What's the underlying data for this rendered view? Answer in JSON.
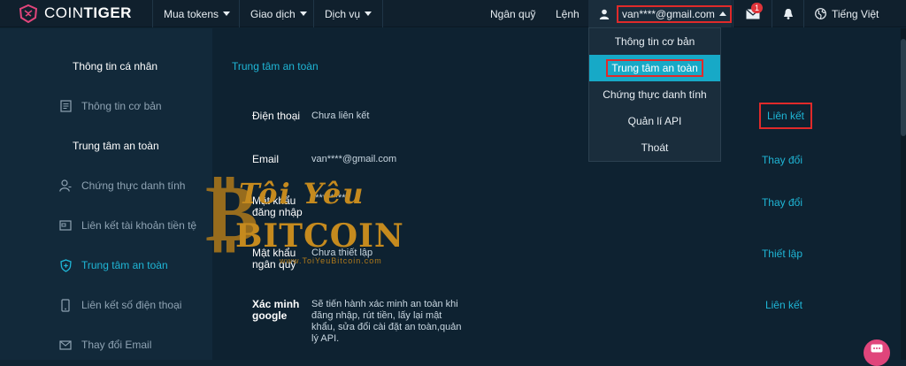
{
  "header": {
    "logo_text_light": "COIN",
    "logo_text_bold": "TIGER",
    "nav": [
      {
        "label": "Mua tokens"
      },
      {
        "label": "Giao dịch"
      },
      {
        "label": "Dịch vụ"
      }
    ],
    "wallet_label": "Ngân quỹ",
    "orders_label": "Lệnh",
    "user_email": "van****@gmail.com",
    "message_badge": "1",
    "language_label": "Tiếng Việt"
  },
  "dropdown": {
    "items": [
      {
        "label": "Thông tin cơ bản"
      },
      {
        "label": "Trung tâm an toàn"
      },
      {
        "label": "Chứng thực danh tính"
      },
      {
        "label": "Quản lí API"
      },
      {
        "label": "Thoát"
      }
    ]
  },
  "sidebar": {
    "section_personal": "Thông tin cá nhân",
    "item_basic_info": "Thông tin cơ bản",
    "section_security": "Trung tâm an toàn",
    "items": [
      {
        "label": "Chứng thực danh tính"
      },
      {
        "label": "Liên kết tài khoản tiền tệ"
      },
      {
        "label": "Trung tâm an toàn"
      },
      {
        "label": "Liên kết số điện thoại"
      },
      {
        "label": "Thay đổi Email"
      }
    ]
  },
  "main": {
    "breadcrumb": "Trung tâm an toàn",
    "rows": [
      {
        "label": "Điện thoại",
        "value": "Chưa liên kết",
        "action": "Liên kết"
      },
      {
        "label": "Email",
        "value": "van****@gmail.com",
        "action": "Thay đổi"
      },
      {
        "label_line1": "Mật khẩu",
        "label_line2": "đăng nhập",
        "value": "**********",
        "action": "Thay đổi"
      },
      {
        "label_line1": "Mật khẩu",
        "label_line2": "ngân quỹ",
        "value": "Chưa thiết lập",
        "action": "Thiết lập"
      },
      {
        "label_line1": "Xác minh",
        "label_line2": "google",
        "value_lines": [
          "Sẽ tiến hành xác minh an toàn khi",
          "đăng nhập, rút tiền, lấy lại mật",
          "khẩu, sửa đổi cài đặt an toàn,quản",
          "lý API."
        ],
        "action": "Liên kết"
      }
    ]
  },
  "watermark": {
    "title": "Tôi Yêu",
    "brand": "BITCOIN",
    "symbol": "₿",
    "url": "www.ToiYeuBitcoin.com"
  },
  "colors": {
    "accent": "#1fb6d6",
    "highlight": "#e02a2a",
    "watermark": "#c58a1e"
  }
}
